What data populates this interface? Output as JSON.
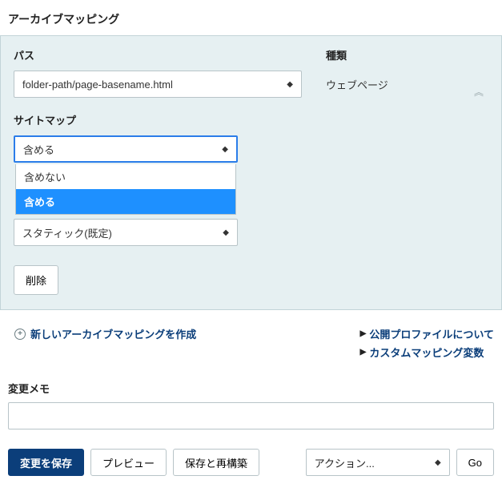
{
  "page_title": "アーカイブマッピング",
  "panel": {
    "path_label": "パス",
    "path_value": "folder-path/page-basename.html",
    "type_label": "種類",
    "type_value": "ウェブページ",
    "sitemap_label": "サイトマップ",
    "sitemap_selected": "含める",
    "sitemap_options": [
      "含めない",
      "含める"
    ],
    "static_selected": "スタティック(既定)",
    "delete_label": "削除"
  },
  "links": {
    "create_label": "新しいアーカイブマッピングを作成",
    "profile_label": "公開プロファイルについて",
    "custom_var_label": "カスタムマッピング変数"
  },
  "memo": {
    "label": "変更メモ"
  },
  "actions": {
    "save_label": "変更を保存",
    "preview_label": "プレビュー",
    "save_rebuild_label": "保存と再構築",
    "action_select_label": "アクション...",
    "go_label": "Go"
  }
}
